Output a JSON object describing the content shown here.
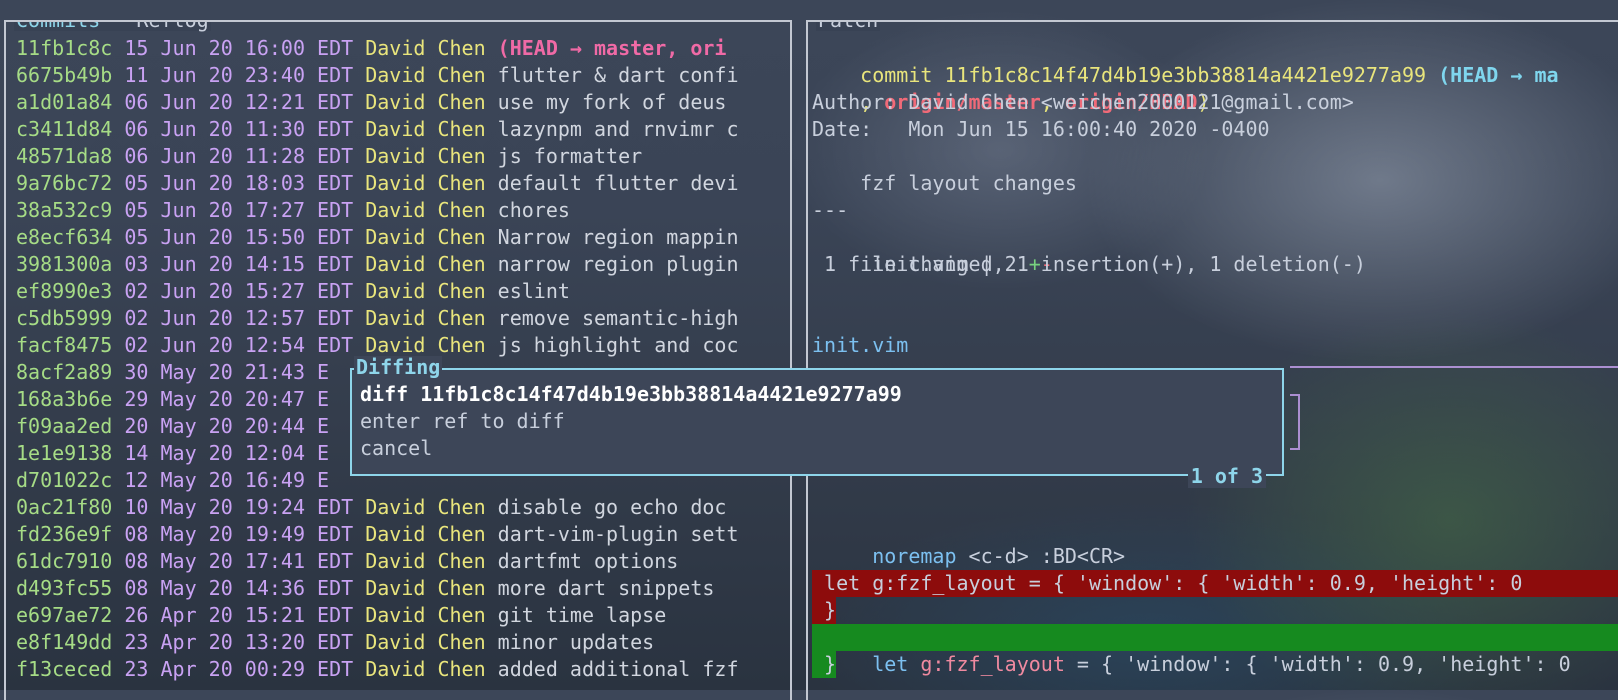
{
  "commits_pane": {
    "title_active": "Commits",
    "title_sep": " - ",
    "title_rest": "Reflog",
    "rows": [
      {
        "hash": "11fb1c8c",
        "date": "15 Jun 20 16:00 EDT",
        "author": "David Chen",
        "msg": "",
        "ref": "(HEAD → master, ori"
      },
      {
        "hash": "6675b49b",
        "date": "11 Jun 20 23:40 EDT",
        "author": "David Chen",
        "msg": "flutter & dart confi"
      },
      {
        "hash": "a1d01a84",
        "date": "06 Jun 20 12:21 EDT",
        "author": "David Chen",
        "msg": "use my fork of deus"
      },
      {
        "hash": "c3411d84",
        "date": "06 Jun 20 11:30 EDT",
        "author": "David Chen",
        "msg": "lazynpm and rnvimr c"
      },
      {
        "hash": "48571da8",
        "date": "06 Jun 20 11:28 EDT",
        "author": "David Chen",
        "msg": "js formatter"
      },
      {
        "hash": "9a76bc72",
        "date": "05 Jun 20 18:03 EDT",
        "author": "David Chen",
        "msg": "default flutter devi"
      },
      {
        "hash": "38a532c9",
        "date": "05 Jun 20 17:27 EDT",
        "author": "David Chen",
        "msg": "chores"
      },
      {
        "hash": "e8ecf634",
        "date": "05 Jun 20 15:50 EDT",
        "author": "David Chen",
        "msg": "Narrow region mappin"
      },
      {
        "hash": "3981300a",
        "date": "03 Jun 20 14:15 EDT",
        "author": "David Chen",
        "msg": "narrow region plugin"
      },
      {
        "hash": "ef8990e3",
        "date": "02 Jun 20 15:27 EDT",
        "author": "David Chen",
        "msg": "eslint"
      },
      {
        "hash": "c5db5999",
        "date": "02 Jun 20 12:57 EDT",
        "author": "David Chen",
        "msg": "remove semantic-high"
      },
      {
        "hash": "facf8475",
        "date": "02 Jun 20 12:54 EDT",
        "author": "David Chen",
        "msg": "js highlight and coc"
      },
      {
        "hash": "8acf2a89",
        "date": "30 May 20 21:43 E",
        "author": "",
        "msg": ""
      },
      {
        "hash": "168a3b6e",
        "date": "29 May 20 20:47 E",
        "author": "",
        "msg": ""
      },
      {
        "hash": "f09aa2ed",
        "date": "20 May 20 20:44 E",
        "author": "",
        "msg": ""
      },
      {
        "hash": "1e1e9138",
        "date": "14 May 20 12:04 E",
        "author": "",
        "msg": ""
      },
      {
        "hash": "d701022c",
        "date": "12 May 20 16:49 E",
        "author": "",
        "msg": ""
      },
      {
        "hash": "0ac21f80",
        "date": "10 May 20 19:24 EDT",
        "author": "David Chen",
        "msg": "disable go echo doc"
      },
      {
        "hash": "fd236e9f",
        "date": "08 May 20 19:49 EDT",
        "author": "David Chen",
        "msg": "dart-vim-plugin sett"
      },
      {
        "hash": "61dc7910",
        "date": "08 May 20 17:41 EDT",
        "author": "David Chen",
        "msg": "dartfmt options"
      },
      {
        "hash": "d493fc55",
        "date": "08 May 20 14:36 EDT",
        "author": "David Chen",
        "msg": "more dart snippets"
      },
      {
        "hash": "e697ae72",
        "date": "26 Apr 20 15:21 EDT",
        "author": "David Chen",
        "msg": "git time lapse"
      },
      {
        "hash": "e8f149dd",
        "date": "23 Apr 20 13:20 EDT",
        "author": "David Chen",
        "msg": "minor updates"
      },
      {
        "hash": "f13ceced",
        "date": "23 Apr 20 00:29 EDT",
        "author": "David Chen",
        "msg": "added additional fzf"
      }
    ]
  },
  "patch_pane": {
    "title": "Patch",
    "commit_prefix": "commit 11fb1c8c14f47d4b19e3bb38814a4421e9277a99 ",
    "head_ref": "(HEAD → ma",
    "ref_line_sep1": ", ",
    "origin_master": "origin/master",
    "ref_line_sep2": ", ",
    "origin_head": "origin/HEAD",
    "ref_line_close": ")",
    "author_line": "Author: David Chen <weichen2000121@gmail.com>",
    "date_line": "Date:   Mon Jun 15 16:00:40 2020 -0400",
    "subject": "    fzf layout changes",
    "separator": "---",
    "stat_file": " init.vim | 2 ",
    "stat_plus": "+",
    "stat_minus": "-",
    "summary": " 1 file changed, 1 insertion(+), 1 deletion(-)",
    "file_name": "init.vim",
    "noremap_kw": " noremap",
    "noremap_rest": " <c-d> :BD<CR>",
    "del_line": " let g:fzf_layout = { 'window': { 'width': 0.9, 'height': 0",
    "del_line2": " }",
    "add_kw": " let",
    "add_var": " g:fzf_layout",
    "add_rest": " = { 'window': { 'width': 0.9, 'height': 0",
    "add_line2": " }"
  },
  "diffing_menu": {
    "title": "Diffing",
    "items": [
      "diff 11fb1c8c14f47d4b19e3bb38814a4421e9277a99",
      "enter ref to diff",
      "cancel"
    ],
    "pager": "1 of 3"
  }
}
